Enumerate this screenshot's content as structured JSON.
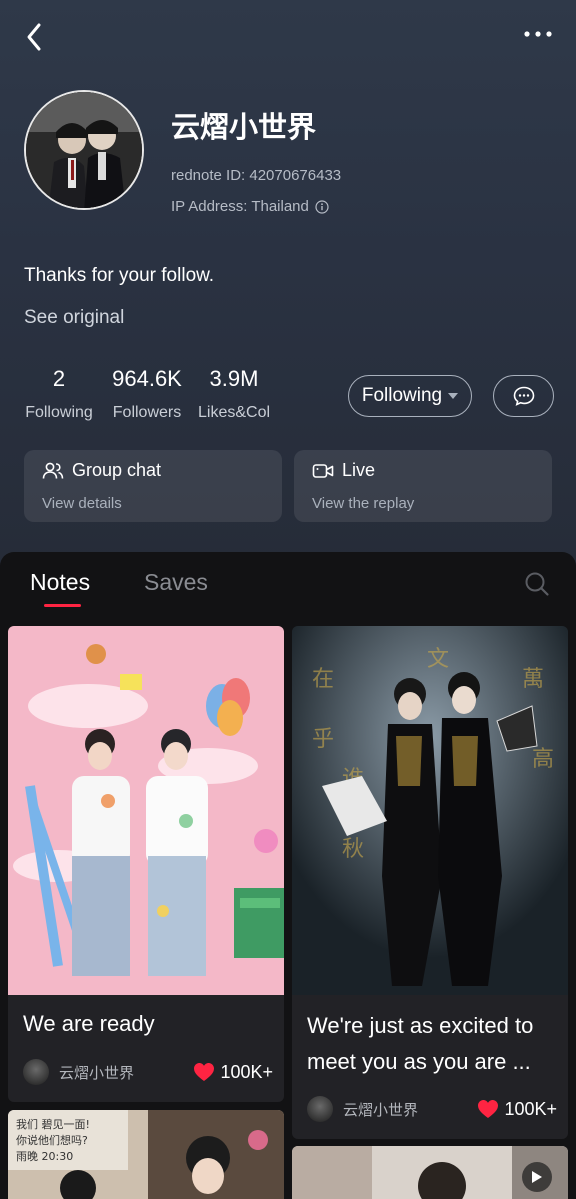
{
  "profile": {
    "name": "云熠小世界",
    "rednote_id": "rednote ID: 42070676433",
    "ip_address": "IP Address: Thailand",
    "bio": "Thanks for your follow.",
    "see_original": "See original"
  },
  "stats": [
    {
      "value": "2",
      "label": "Following"
    },
    {
      "value": "964.6K",
      "label": "Followers"
    },
    {
      "value": "3.9M",
      "label": "Likes&Col"
    }
  ],
  "actions": {
    "following_label": "Following"
  },
  "cards": {
    "group_chat": {
      "title": "Group chat",
      "sub": "View details"
    },
    "live": {
      "title": "Live",
      "sub": "View the replay"
    }
  },
  "tabs": [
    {
      "label": "Notes",
      "active": true
    },
    {
      "label": "Saves",
      "active": false
    }
  ],
  "notes": [
    {
      "title": "We are ready",
      "author": "云熠小世界",
      "likes": "100K+"
    },
    {
      "title": "We're just as excited to meet you as you are ...",
      "author": "云熠小世界",
      "likes": "100K+"
    }
  ],
  "colors": {
    "accent": "#ff2442",
    "header_bg": "#2c3545",
    "page_bg": "#121214",
    "card_bg": "#222226"
  }
}
